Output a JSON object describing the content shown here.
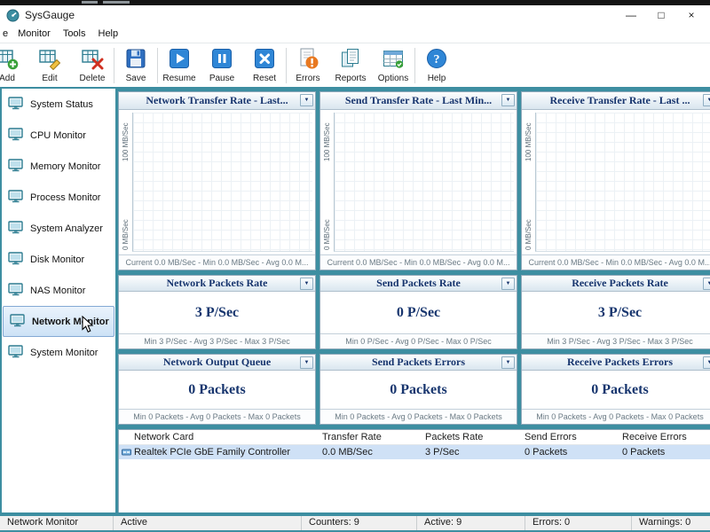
{
  "titlebar": {
    "title": "SysGauge",
    "minimize": "—",
    "maximize": "□",
    "close": "×"
  },
  "menubar": {
    "items": [
      {
        "label": "e"
      },
      {
        "label": "Monitor"
      },
      {
        "label": "Tools"
      },
      {
        "label": "Help"
      }
    ]
  },
  "toolbar": {
    "items": [
      {
        "label": "Add"
      },
      {
        "label": "Edit"
      },
      {
        "label": "Delete"
      },
      {
        "label": "Save"
      },
      {
        "label": "Resume"
      },
      {
        "label": "Pause"
      },
      {
        "label": "Reset"
      },
      {
        "label": "Errors"
      },
      {
        "label": "Reports"
      },
      {
        "label": "Options"
      },
      {
        "label": "Help"
      }
    ]
  },
  "sidebar": {
    "items": [
      {
        "label": "System Status"
      },
      {
        "label": "CPU Monitor"
      },
      {
        "label": "Memory Monitor"
      },
      {
        "label": "Process Monitor"
      },
      {
        "label": "System Analyzer"
      },
      {
        "label": "Disk Monitor"
      },
      {
        "label": "NAS Monitor"
      },
      {
        "label": "Network Monitor",
        "selected": true
      },
      {
        "label": "System Monitor"
      }
    ]
  },
  "panel_menu_arrow": "▼",
  "charts": [
    {
      "title": "Network Transfer Rate - Last...",
      "y_top": "100 MB/Sec",
      "y_bottom": "0 MB/Sec",
      "footer": "Current 0.0 MB/Sec - Min 0.0 MB/Sec - Avg 0.0 M..."
    },
    {
      "title": "Send Transfer Rate - Last Min...",
      "y_top": "100 MB/Sec",
      "y_bottom": "0 MB/Sec",
      "footer": "Current 0.0 MB/Sec - Min 0.0 MB/Sec - Avg 0.0 M..."
    },
    {
      "title": "Receive Transfer Rate - Last ...",
      "y_top": "100 MB/Sec",
      "y_bottom": "0 MB/Sec",
      "footer": "Current 0.0 MB/Sec - Min 0.0 MB/Sec - Avg 0.0 M..."
    }
  ],
  "gauges": [
    {
      "title": "Network Packets Rate",
      "value": "3 P/Sec",
      "footer": "Min 3 P/Sec - Avg 3 P/Sec - Max 3 P/Sec"
    },
    {
      "title": "Send Packets Rate",
      "value": "0 P/Sec",
      "footer": "Min 0 P/Sec - Avg 0 P/Sec - Max 0 P/Sec"
    },
    {
      "title": "Receive Packets Rate",
      "value": "3 P/Sec",
      "footer": "Min 3 P/Sec - Avg 3 P/Sec - Max 3 P/Sec"
    },
    {
      "title": "Network Output Queue",
      "value": "0 Packets",
      "footer": "Min 0 Packets - Avg 0 Packets - Max 0 Packets"
    },
    {
      "title": "Send Packets Errors",
      "value": "0 Packets",
      "footer": "Min 0 Packets - Avg 0 Packets - Max 0 Packets"
    },
    {
      "title": "Receive Packets Errors",
      "value": "0 Packets",
      "footer": "Min 0 Packets - Avg 0 Packets - Max 0 Packets"
    }
  ],
  "table": {
    "headers": [
      "Network Card",
      "Transfer Rate",
      "Packets Rate",
      "Send Errors",
      "Receive Errors"
    ],
    "rows": [
      {
        "name": "Realtek PCIe GbE Family Controller",
        "transfer_rate": "0.0 MB/Sec",
        "packets_rate": "3 P/Sec",
        "send_errors": "0 Packets",
        "receive_errors": "0 Packets"
      }
    ]
  },
  "statusbar": {
    "items": [
      "Network Monitor",
      "Active",
      "Counters: 9",
      "Active: 9",
      "Errors: 0",
      "Warnings: 0"
    ]
  },
  "colors": {
    "accent_teal": "#3d8ea1",
    "navy_text": "#17356e",
    "selection_blue": "#cfe1f6"
  }
}
